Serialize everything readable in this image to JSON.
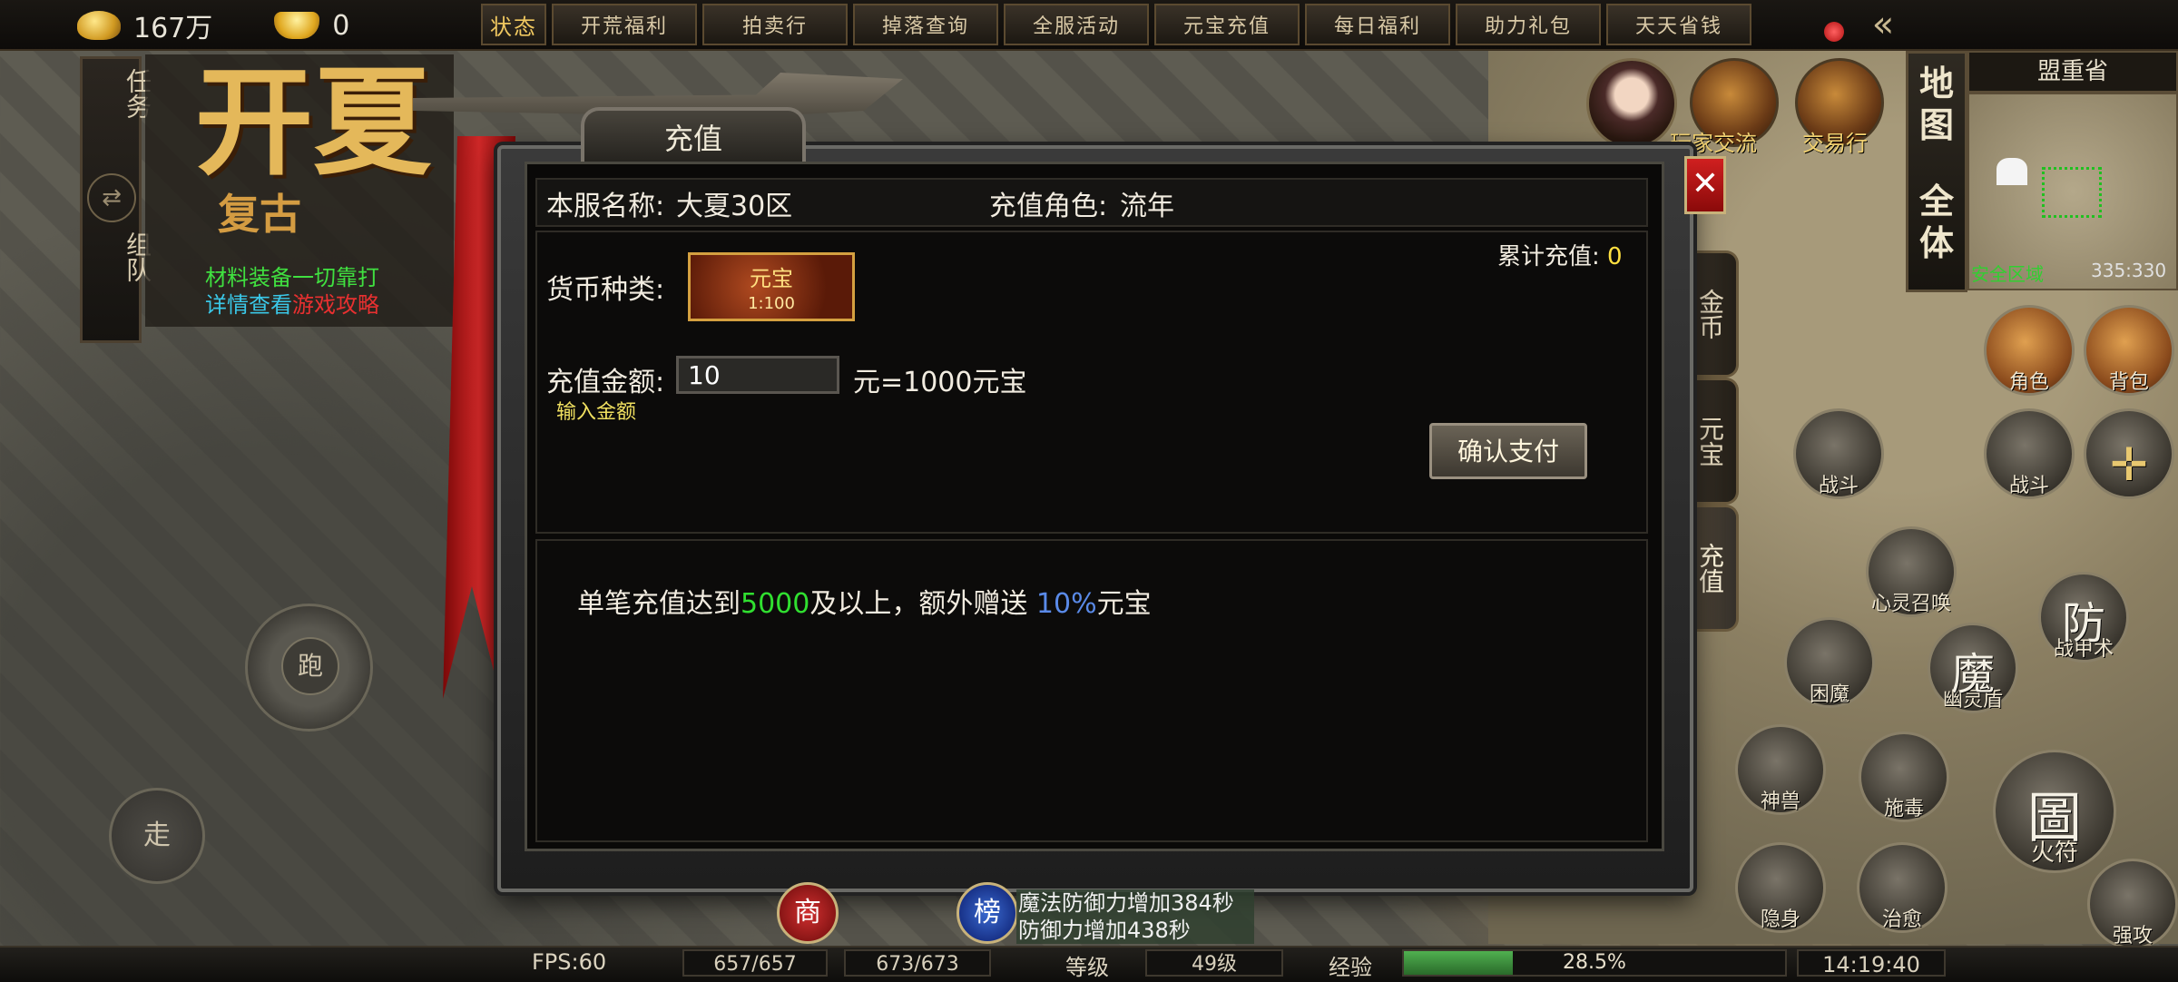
{
  "currency": {
    "gold": "167万",
    "ingot": "0"
  },
  "top_menu": [
    "状态",
    "开荒福利",
    "拍卖行",
    "掉落查询",
    "全服活动",
    "元宝充值",
    "每日福利",
    "助力礼包",
    "天天省钱"
  ],
  "left_panel": {
    "tab_quest": "任务",
    "tab_team": "组队",
    "logo_title": "开夏",
    "logo_sub": "复古",
    "promo_line1": "材料装备一切靠打",
    "promo_line2_prefix": "详情查看",
    "promo_line2_link": "游戏攻略"
  },
  "controls": {
    "run": "跑",
    "walk": "走"
  },
  "map": {
    "tab_map": "地图",
    "tab_all": "全体",
    "province": "盟重省",
    "safe_zone": "安全区域",
    "coords": "335:330"
  },
  "top_icons": {
    "player_exchange": "玩家交流",
    "trade": "交易行"
  },
  "skills": {
    "role": "角色",
    "bag": "背包",
    "fight1": "战斗",
    "fight2": "战斗",
    "soul": "心灵召唤",
    "armor": "战甲术",
    "armor_glyph": "防",
    "trap": "困魔",
    "ghost": "幽灵盾",
    "ghost_glyph": "魔",
    "beast": "神兽",
    "poison": "施毒",
    "talisman": "火符",
    "talisman_glyph": "圖",
    "hide": "隐身",
    "heal": "治愈",
    "strong": "强攻"
  },
  "side_tabs": [
    "金币",
    "元宝",
    "充值"
  ],
  "dialog": {
    "title": "充值",
    "server_label": "本服名称:",
    "server_value": "大夏30区",
    "role_label": "充值角色:",
    "role_value": "流年",
    "total_label": "累计充值:",
    "total_value": "0",
    "currency_label": "货币种类:",
    "currency_card_name": "元宝",
    "currency_card_rate": "1:100",
    "amount_label": "充值金额:",
    "amount_value": "10",
    "amount_result": "元=1000元宝",
    "amount_hint": "输入金额",
    "confirm": "确认支付",
    "bonus_prefix": "单笔充值达到",
    "bonus_threshold": "5000",
    "bonus_middle": "及以上，额外赠送",
    "bonus_percent": "10%",
    "bonus_suffix": "元宝"
  },
  "hud": {
    "fps": "FPS:60",
    "hp": "657/657",
    "mp": "673/673",
    "level_label": "等级",
    "level_value": "49级",
    "exp_label": "经验",
    "exp_value": "28.5%",
    "exp_fraction": 0.285,
    "time": "14:19:40",
    "shop": "商",
    "rank": "榜"
  },
  "messages": [
    "魔法防御力增加384秒",
    "防御力增加438秒"
  ]
}
